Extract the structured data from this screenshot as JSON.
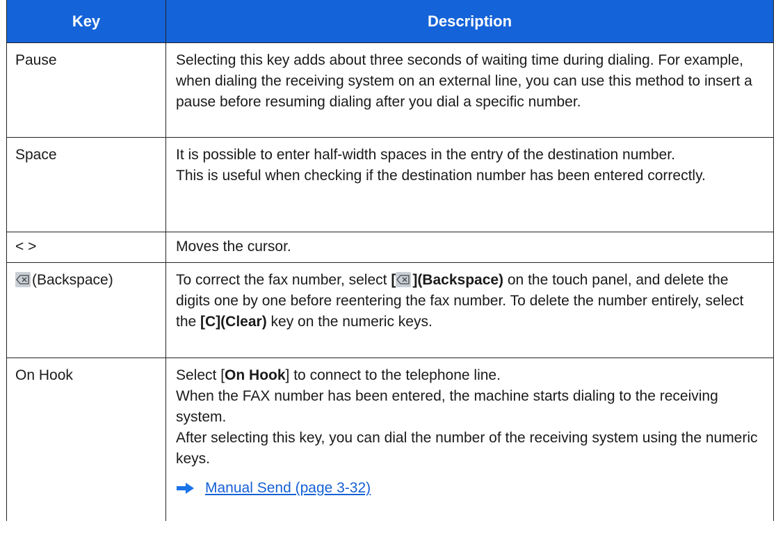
{
  "header": {
    "key": "Key",
    "description": "Description"
  },
  "rows": [
    {
      "key": "Pause",
      "description": "Selecting this key adds about three seconds of waiting time during dialing. For example, when dialing the receiving system on an external line, you can use this method to insert a pause before resuming dialing after you dial a specific number."
    },
    {
      "key": "Space",
      "description_1": "It is possible to enter half-width spaces in the entry of the destination number.",
      "description_2": "This is useful when checking if the destination number has been entered correctly."
    },
    {
      "key": "< >",
      "description": "Moves the cursor."
    },
    {
      "key_icon": "backspace-icon",
      "key": "(Backspace)",
      "desc_a": "To correct the fax number, select ",
      "desc_bold_1": "(Backspace)",
      "desc_b": " on the touch panel, and delete the digits one by one before reentering the fax number. To delete the number entirely, select the ",
      "desc_bold_2": "[C](Clear)",
      "desc_c": " key on the numeric keys."
    },
    {
      "key": "On Hook",
      "desc_a": "Select [",
      "desc_bold": "On Hook",
      "desc_b": "] to connect to the telephone line.",
      "desc_2": "When the FAX number has been entered, the machine starts dialing to the receiving system.",
      "desc_3": "After selecting this key, you can dial the number of the receiving system using the numeric keys.",
      "link_icon": "arrow-right-icon",
      "link": "Manual Send (page 3-32)"
    }
  ],
  "colors": {
    "header_bg": "#1463d8",
    "link": "#1560d4",
    "arrow": "#1a73e8"
  }
}
